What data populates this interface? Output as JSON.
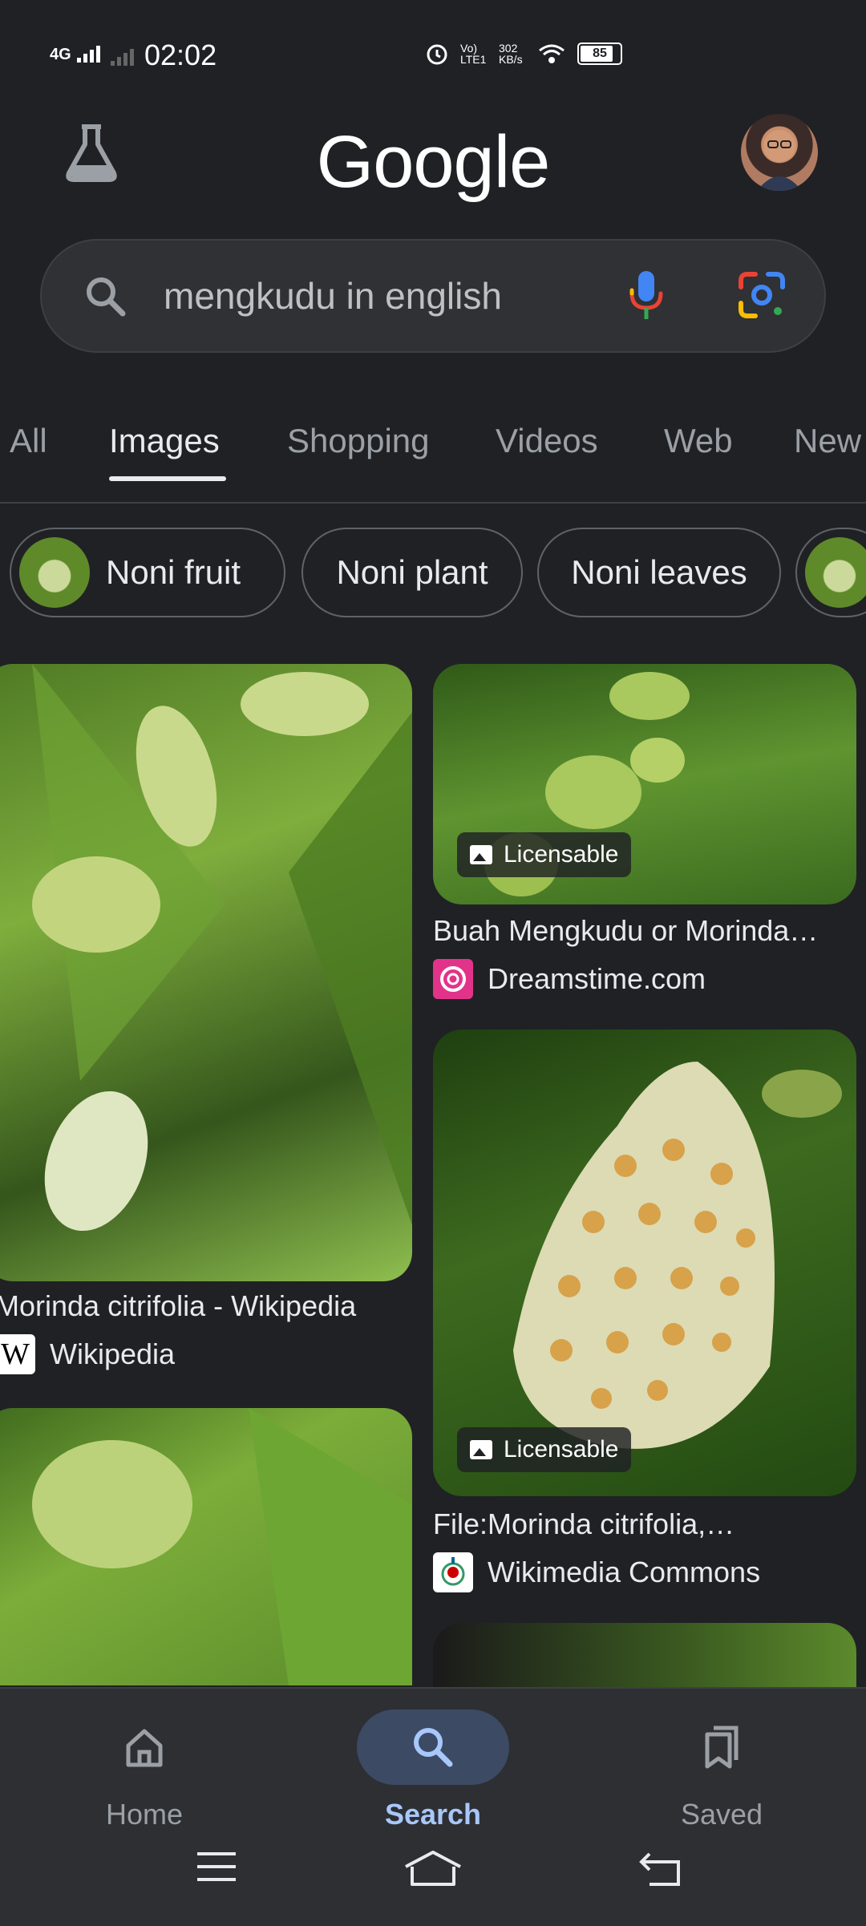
{
  "status_bar": {
    "network": "4G",
    "time": "02:02",
    "volte": "Vo) LTE1",
    "speed": "302 KB/s",
    "battery": "85"
  },
  "header": {
    "logo": "Google",
    "labs_icon": "flask-icon",
    "avatar": "account-avatar"
  },
  "search": {
    "query": "mengkudu in english",
    "icons": [
      "search-icon",
      "mic-icon",
      "lens-icon"
    ]
  },
  "tabs": [
    {
      "label": "All"
    },
    {
      "label": "Images"
    },
    {
      "label": "Shopping"
    },
    {
      "label": "Videos"
    },
    {
      "label": "Web"
    },
    {
      "label": "New"
    }
  ],
  "chips": [
    {
      "label": "Noni fruit"
    },
    {
      "label": "Noni plant"
    },
    {
      "label": "Noni leaves"
    }
  ],
  "results": [
    {
      "title": "Morinda citrifolia - Wikipedia",
      "source": "Wikipedia",
      "badge": ""
    },
    {
      "title": "Buah Mengkudu or Morinda…",
      "source": "Dreamstime.com",
      "badge": "Licensable"
    },
    {
      "title": "File:Morinda citrifolia,…",
      "source": "Wikimedia Commons",
      "badge": "Licensable"
    }
  ],
  "bottom_nav": {
    "items": [
      {
        "label": "Home",
        "icon": "home-icon"
      },
      {
        "label": "Search",
        "icon": "search-icon"
      },
      {
        "label": "Saved",
        "icon": "bookmarks-icon"
      }
    ]
  },
  "colors": {
    "background": "#202124",
    "surface": "#303134",
    "active_tab": "#e8eaed",
    "active_nav": "#a8c7fa"
  }
}
